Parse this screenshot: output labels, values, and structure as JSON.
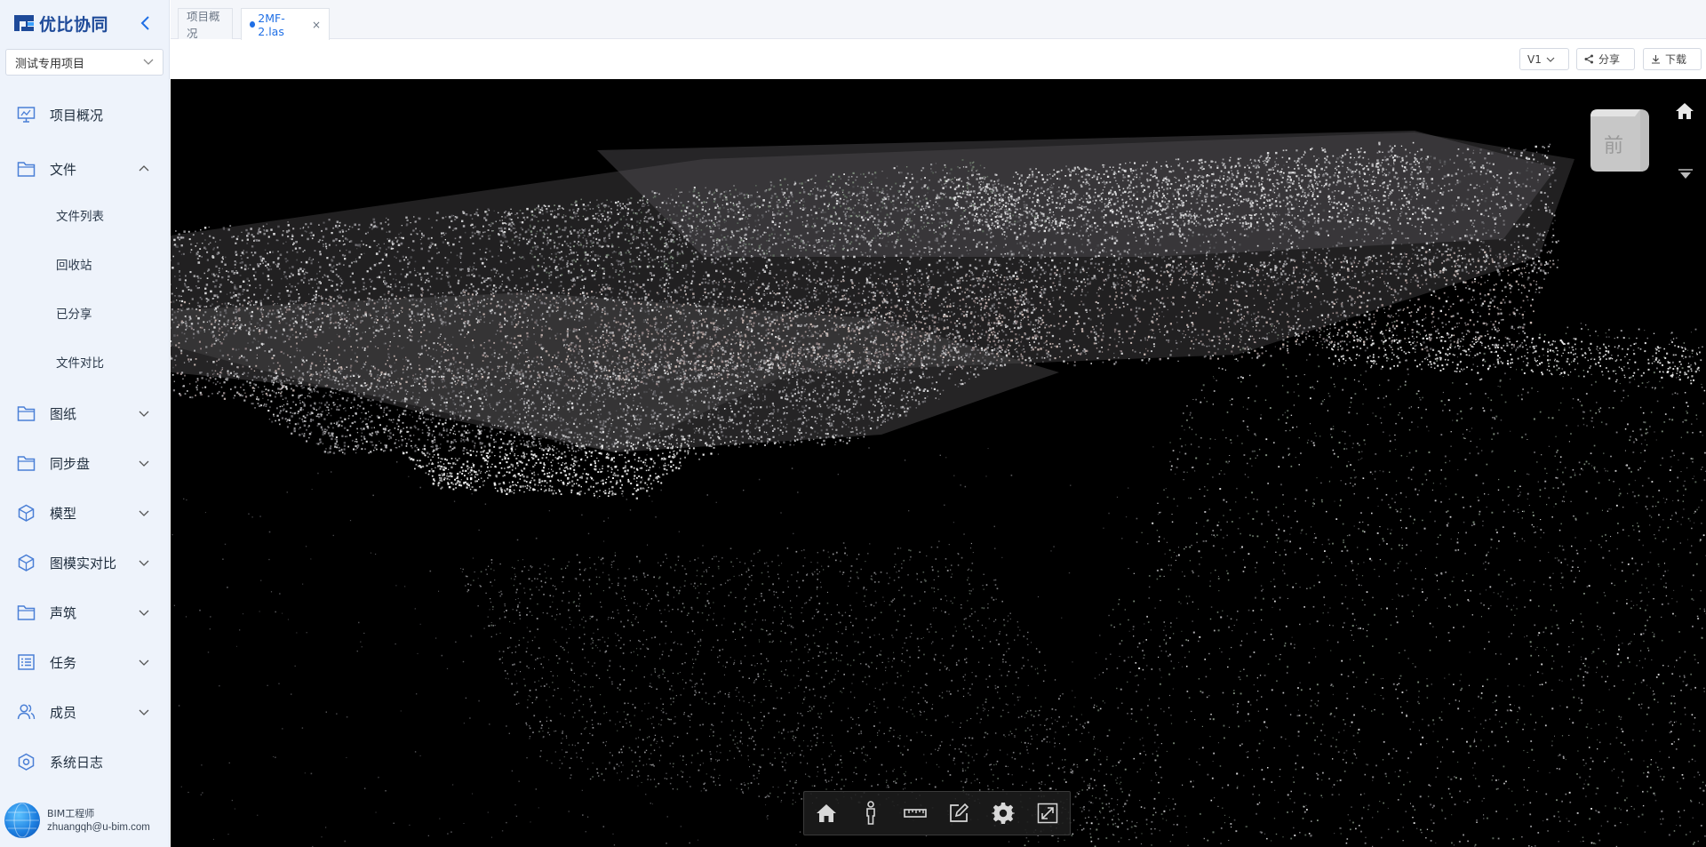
{
  "app": {
    "logo_text": "优比协同",
    "project_selector": "测试专用项目"
  },
  "sidebar": {
    "items": [
      {
        "label": "项目概况",
        "icon": "monitor-icon"
      },
      {
        "label": "文件",
        "icon": "folder-icon",
        "expanded": true,
        "children": [
          {
            "label": "文件列表"
          },
          {
            "label": "回收站"
          },
          {
            "label": "已分享"
          },
          {
            "label": "文件对比"
          }
        ]
      },
      {
        "label": "图纸",
        "icon": "folder-icon"
      },
      {
        "label": "同步盘",
        "icon": "folder-icon"
      },
      {
        "label": "模型",
        "icon": "cube-icon"
      },
      {
        "label": "图模实对比",
        "icon": "cube-icon"
      },
      {
        "label": "声筑",
        "icon": "folder-icon"
      },
      {
        "label": "任务",
        "icon": "task-list-icon"
      },
      {
        "label": "成员",
        "icon": "users-icon"
      },
      {
        "label": "系统日志",
        "icon": "settings-hex-icon"
      }
    ]
  },
  "user": {
    "role": "BIM工程师",
    "email": "zhuangqh@u-bim.com"
  },
  "tabs": [
    {
      "label": "项目概况",
      "active": false
    },
    {
      "label": "2MF-2.las",
      "active": true
    }
  ],
  "toolbar": {
    "version": "V1",
    "share": "分享",
    "download": "下载"
  },
  "viewer": {
    "nav_cube_face": "前",
    "tools": [
      "home-icon",
      "person-walk-icon",
      "ruler-icon",
      "annotate-icon",
      "gear-icon",
      "fullscreen-icon"
    ]
  },
  "colors": {
    "sidebar_bg": "#eef3fb",
    "accent": "#1f6fe5",
    "brand": "#1e4a99",
    "viewer_bg": "#000000"
  }
}
